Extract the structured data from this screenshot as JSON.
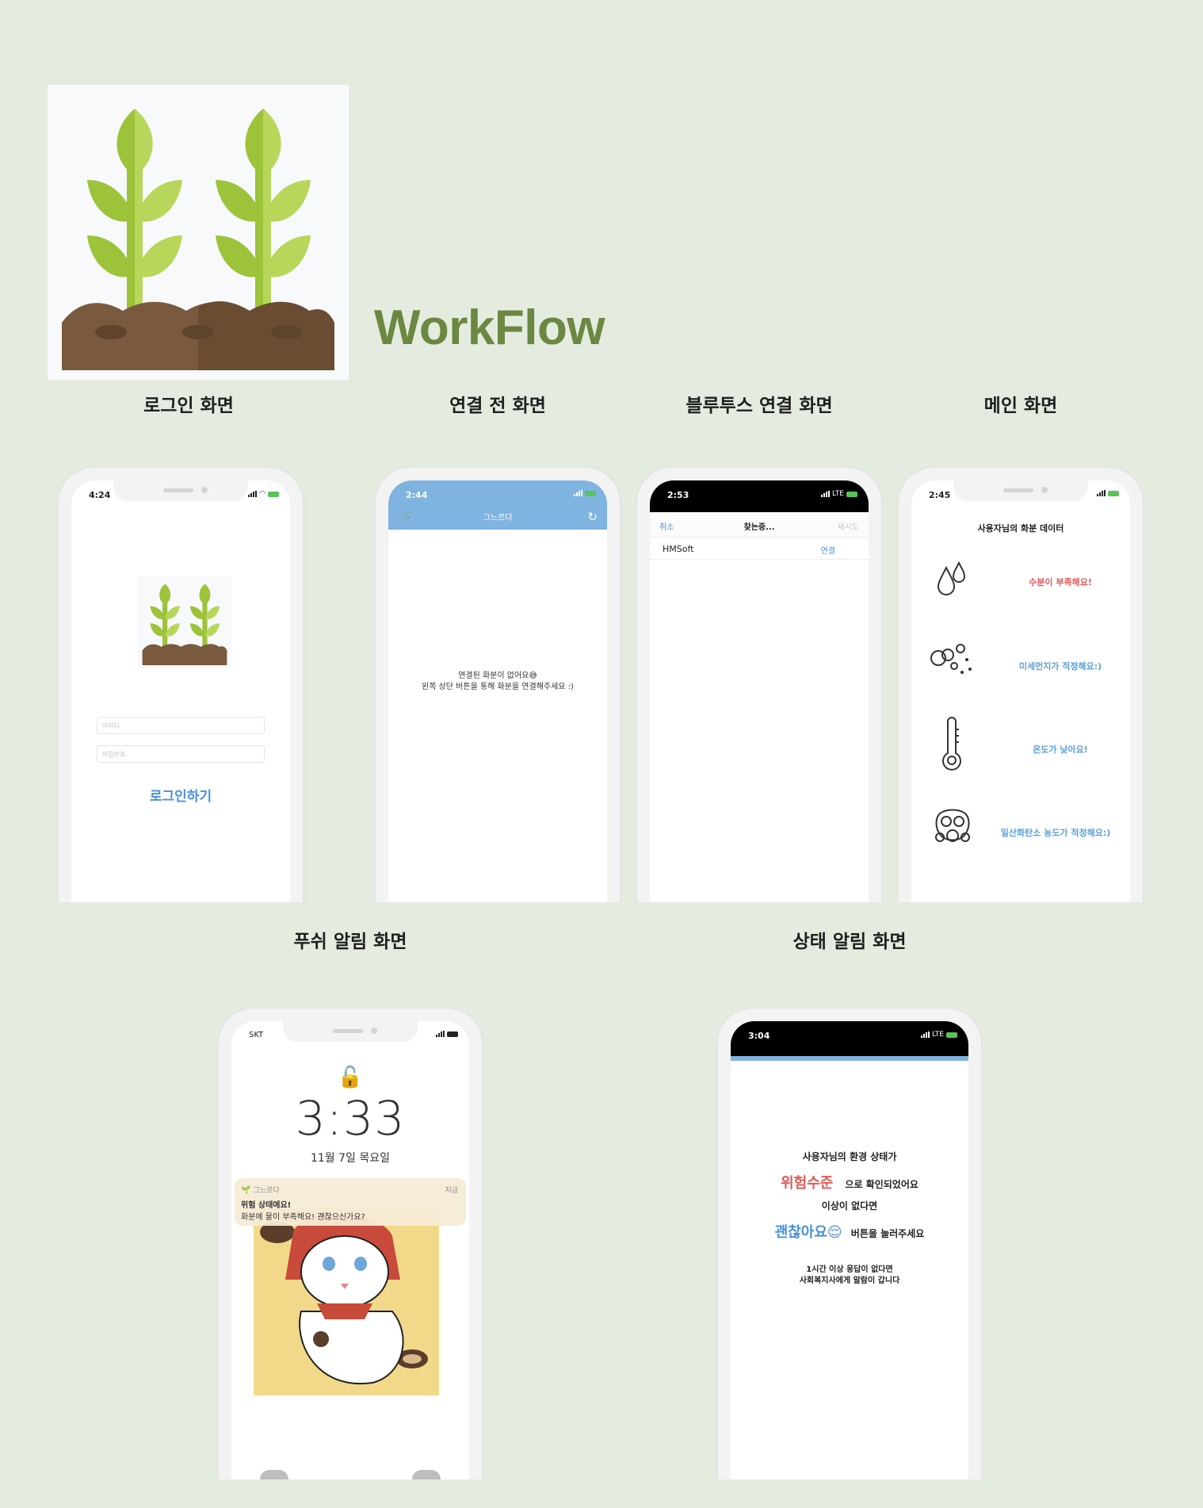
{
  "header": {
    "title": "WorkFlow"
  },
  "sections": {
    "login": "로그인 화면",
    "before_connect": "연결 전 화면",
    "bluetooth": "블루투스 연결 화면",
    "main": "메인 화면",
    "push": "푸쉬 알림 화면",
    "status": "상태 알림 화면"
  },
  "login_screen": {
    "time": "4:24",
    "id_placeholder": "아이디",
    "pw_placeholder": "비밀번호",
    "login_button": "로그인하기"
  },
  "before_connect_screen": {
    "time": "2:44",
    "nav_title": "그느르다",
    "message_line1": "연결된 화분이 없어요😅",
    "message_line2": "왼쪽 상단 버튼을 통해 화분을 연결해주세요 :)"
  },
  "bluetooth_screen": {
    "time": "2:53",
    "network": "LTE",
    "cancel": "취소",
    "searching": "찾는중...",
    "retry": "재시도",
    "device_name": "HMSoft",
    "connect": "연결"
  },
  "main_screen": {
    "time": "2:45",
    "title": "사용자님의 화분 데이터",
    "items": [
      {
        "icon": "water-drops-icon",
        "text": "수분이 부족해요!",
        "color": "#e05a5a"
      },
      {
        "icon": "dust-icon",
        "text": "미세먼지가 적정해요:)",
        "color": "#5aa0d8"
      },
      {
        "icon": "thermometer-icon",
        "text": "온도가 낮아요!",
        "color": "#5aa0d8"
      },
      {
        "icon": "gas-mask-icon",
        "text": "일산화탄소 농도가 적정해요:)",
        "color": "#5aa0d8"
      }
    ]
  },
  "push_screen": {
    "carrier": "SKT",
    "clock": "3:33",
    "date": "11월 7일 목요일",
    "notif_app": "그느르다",
    "notif_time": "지금",
    "notif_title": "위험 상태에요!",
    "notif_body": "화분에 물이 부족해요! 괜찮으신가요?"
  },
  "status_screen": {
    "time": "3:04",
    "network": "LTE",
    "line1": "사용자님의 환경 상태가",
    "danger_word": "위험수준",
    "line2_suffix": "으로 확인되었어요",
    "line3": "이상이 없다면",
    "ok_word": "괜찮아요😌",
    "line4_suffix": "버튼을 눌러주세요",
    "note_line1": "1시간 이상 응답이 없다면",
    "note_line2": "사회복지사에게 알람이 갑니다"
  },
  "colors": {
    "background": "#e3ecdf",
    "title_green": "#6b8741",
    "danger_red": "#e05a5a",
    "ok_blue": "#4a90d9"
  }
}
